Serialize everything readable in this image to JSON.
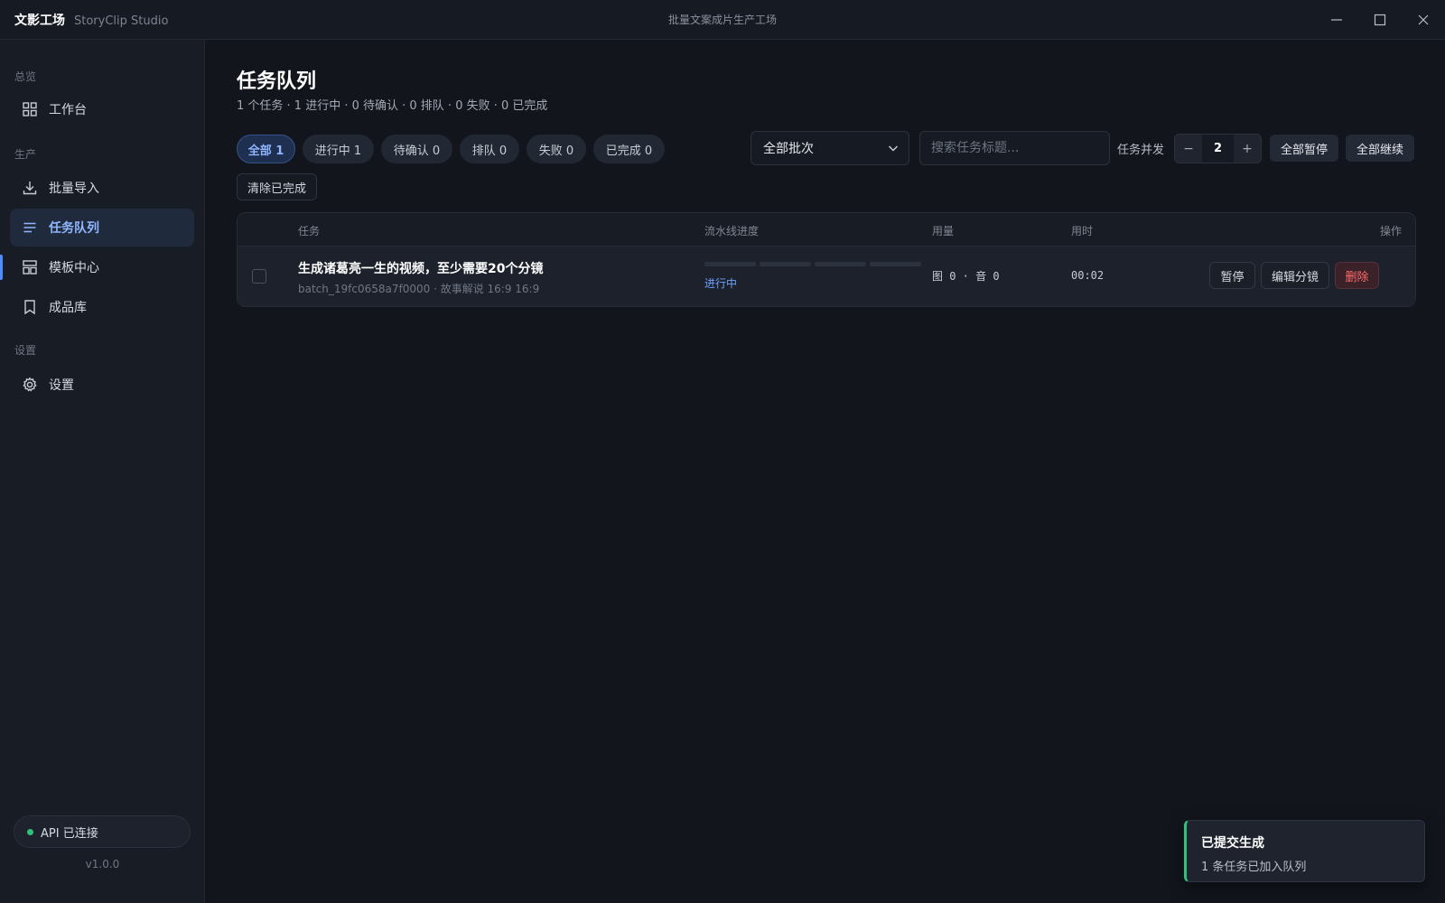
{
  "app": {
    "name": "文影工场",
    "subtitle": "StoryClip Studio",
    "window_title": "批量文案成片生产工场"
  },
  "sidebar": {
    "sections": [
      {
        "label": "总览"
      },
      {
        "label": "生产"
      },
      {
        "label": "设置"
      }
    ],
    "items": [
      {
        "label": "工作台",
        "icon": "grid-icon"
      },
      {
        "label": "批量导入",
        "icon": "download-icon"
      },
      {
        "label": "任务队列",
        "icon": "list-icon",
        "active": true
      },
      {
        "label": "模板中心",
        "icon": "template-icon"
      },
      {
        "label": "成品库",
        "icon": "bookmark-icon"
      },
      {
        "label": "设置",
        "icon": "gear-icon"
      }
    ],
    "api_status": "API 已连接",
    "api_status_color": "#2fc27a",
    "version": "v1.0.0"
  },
  "page": {
    "title": "任务队列",
    "summary": "1 个任务 · 1 进行中 · 0 待确认 · 0 排队 · 0 失败 · 0 已完成"
  },
  "filters": {
    "chips": [
      {
        "label": "全部 1",
        "active": true
      },
      {
        "label": "进行中 1"
      },
      {
        "label": "待确认 0"
      },
      {
        "label": "排队 0"
      },
      {
        "label": "失败 0"
      },
      {
        "label": "已完成 0"
      }
    ],
    "batch_select": "全部批次",
    "search_placeholder": "搜索任务标题...",
    "concurrency_label": "任务并发",
    "concurrency_value": "2",
    "pause_all": "全部暂停",
    "resume_all": "全部继续",
    "clear_done": "清除已完成"
  },
  "table": {
    "headers": {
      "task": "任务",
      "pipeline": "流水线进度",
      "usage": "用量",
      "duration": "用时",
      "actions": "操作"
    },
    "rows": [
      {
        "title": "生成诸葛亮一生的视频，至少需要20个分镜",
        "meta": "batch_19fc0658a7f0000 · 故事解说 16:9 16:9",
        "status": "进行中",
        "usage": "图 0 · 音 0",
        "duration": "00:02",
        "actions": {
          "pause": "暂停",
          "edit": "编辑分镜",
          "delete": "删除"
        }
      }
    ]
  },
  "toast": {
    "title": "已提交生成",
    "body": "1 条任务已加入队列",
    "accent": "#2fc27a"
  },
  "colors": {
    "accent": "#4c8dff",
    "danger": "#ff6b6b",
    "background": "#12151c"
  }
}
